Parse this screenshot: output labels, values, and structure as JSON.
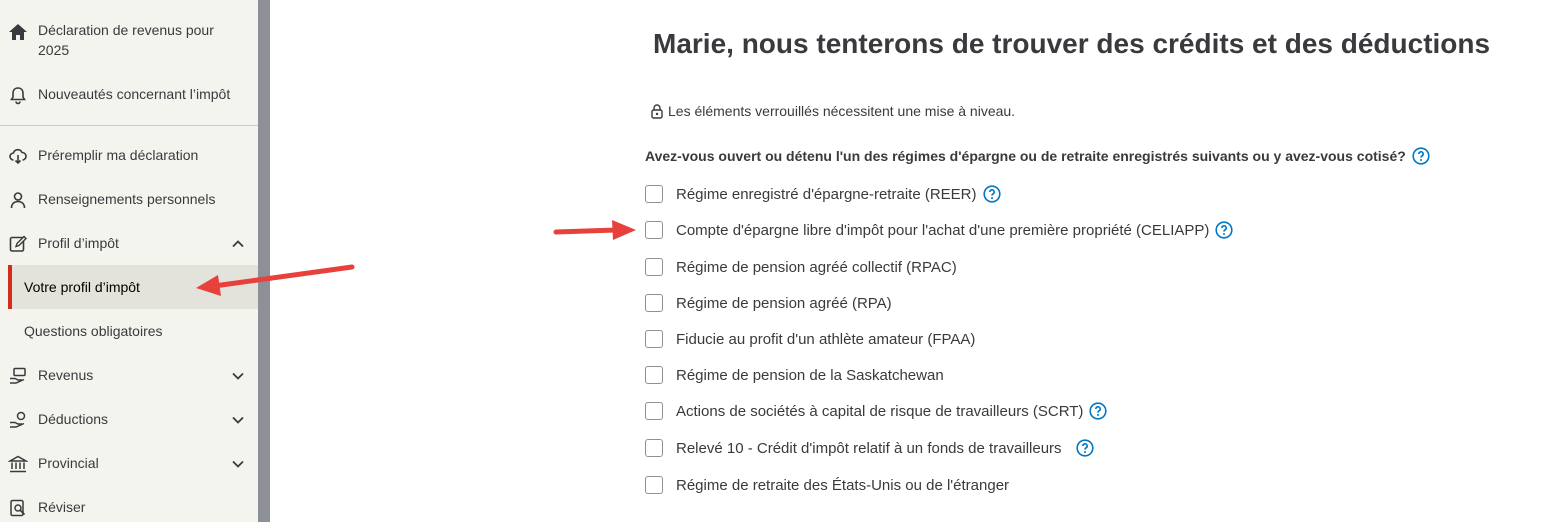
{
  "sidebar": {
    "items": [
      {
        "label": "Déclaration de revenus pour 2025",
        "icon": "home-icon"
      },
      {
        "label": "Nouveautés concernant l’impôt",
        "icon": "bell-icon"
      },
      {
        "label": "Préremplir ma déclaration",
        "icon": "cloud-download-icon"
      },
      {
        "label": "Renseignements personnels",
        "icon": "person-icon"
      },
      {
        "label": "Profil d’impôt",
        "icon": "edit-icon"
      },
      {
        "label": "Votre profil d’impôt"
      },
      {
        "label": "Questions obligatoires"
      },
      {
        "label": "Revenus",
        "icon": "income-icon"
      },
      {
        "label": "Déductions",
        "icon": "deductions-icon"
      },
      {
        "label": "Provincial",
        "icon": "building-icon"
      },
      {
        "label": "Réviser",
        "icon": "review-icon"
      }
    ],
    "active_accent": "#d52b1e"
  },
  "main": {
    "title": "Marie, nous tenterons de trouver des crédits et des déductions",
    "lock_note": "Les éléments verrouillés nécessitent une mise à niveau.",
    "question": "Avez-vous ouvert ou détenu l'un des régimes d'épargne ou de retraite enregistrés suivants ou y avez-vous cotisé?",
    "options": [
      {
        "label": "Régime enregistré d'épargne-retraite (REER)",
        "checked": false,
        "help": true
      },
      {
        "label": "Compte d'épargne libre d'impôt pour l'achat d'une première propriété (CELIAPP)",
        "checked": false,
        "help": true
      },
      {
        "label": "Régime de pension agréé collectif (RPAC)",
        "checked": false,
        "help": false
      },
      {
        "label": "Régime de pension agréé (RPA)",
        "checked": false,
        "help": false
      },
      {
        "label": "Fiducie au profit d'un athlète amateur (FPAA)",
        "checked": false,
        "help": false
      },
      {
        "label": "Régime de pension de la Saskatchewan",
        "checked": false,
        "help": false
      },
      {
        "label": "Actions de sociétés à capital de risque de travailleurs (SCRT)",
        "checked": false,
        "help": true
      },
      {
        "label": "Relevé 10 - Crédit d'impôt relatif à un fonds de travailleurs",
        "checked": false,
        "help": true
      },
      {
        "label": "Régime de retraite des États-Unis ou de l'étranger",
        "checked": false,
        "help": false
      }
    ]
  },
  "colors": {
    "help": "#0077c5",
    "annotation_arrow": "#e8413c"
  }
}
